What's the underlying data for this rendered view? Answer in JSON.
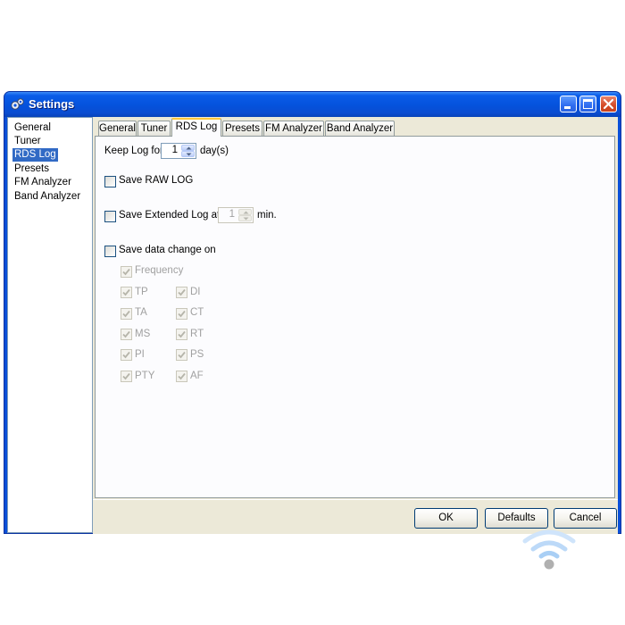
{
  "window": {
    "title": "Settings"
  },
  "title_icons": [
    "gears-icon",
    "minimize-icon",
    "maximize-icon",
    "close-icon"
  ],
  "sidebar": {
    "items": [
      {
        "label": "General"
      },
      {
        "label": "Tuner"
      },
      {
        "label": "RDS Log",
        "selected": true
      },
      {
        "label": "Presets"
      },
      {
        "label": "FM Analyzer"
      },
      {
        "label": "Band Analyzer"
      }
    ]
  },
  "tabs": [
    {
      "label": "General"
    },
    {
      "label": "Tuner"
    },
    {
      "label": "RDS Log",
      "active": true
    },
    {
      "label": "Presets"
    },
    {
      "label": "FM Analyzer"
    },
    {
      "label": "Band Analyzer"
    }
  ],
  "rds_log": {
    "keep_log_label": "Keep Log for",
    "keep_log_value": "1",
    "keep_log_unit": "day(s)",
    "save_raw_label": "Save RAW LOG",
    "save_raw_checked": false,
    "save_extended_label": "Save Extended Log at",
    "save_extended_checked": false,
    "save_extended_value": "1",
    "save_extended_unit": "min.",
    "save_data_change_label": "Save data change on",
    "save_data_change_checked": false,
    "fields": {
      "frequency": {
        "label": "Frequency",
        "checked": true
      },
      "tp": {
        "label": "TP",
        "checked": true
      },
      "di": {
        "label": "DI",
        "checked": true
      },
      "ta": {
        "label": "TA",
        "checked": true
      },
      "ct": {
        "label": "CT",
        "checked": true
      },
      "ms": {
        "label": "MS",
        "checked": true
      },
      "rt": {
        "label": "RT",
        "checked": true
      },
      "pi": {
        "label": "PI",
        "checked": true
      },
      "ps": {
        "label": "PS",
        "checked": true
      },
      "pty": {
        "label": "PTY",
        "checked": true
      },
      "af": {
        "label": "AF",
        "checked": true
      }
    }
  },
  "buttons": {
    "ok": "OK",
    "defaults": "Defaults",
    "cancel": "Cancel"
  },
  "colors": {
    "titlebar": "#0552dc",
    "selection": "#316ac5",
    "face": "#ece9d8",
    "tab_highlight": "#ffc83c"
  }
}
